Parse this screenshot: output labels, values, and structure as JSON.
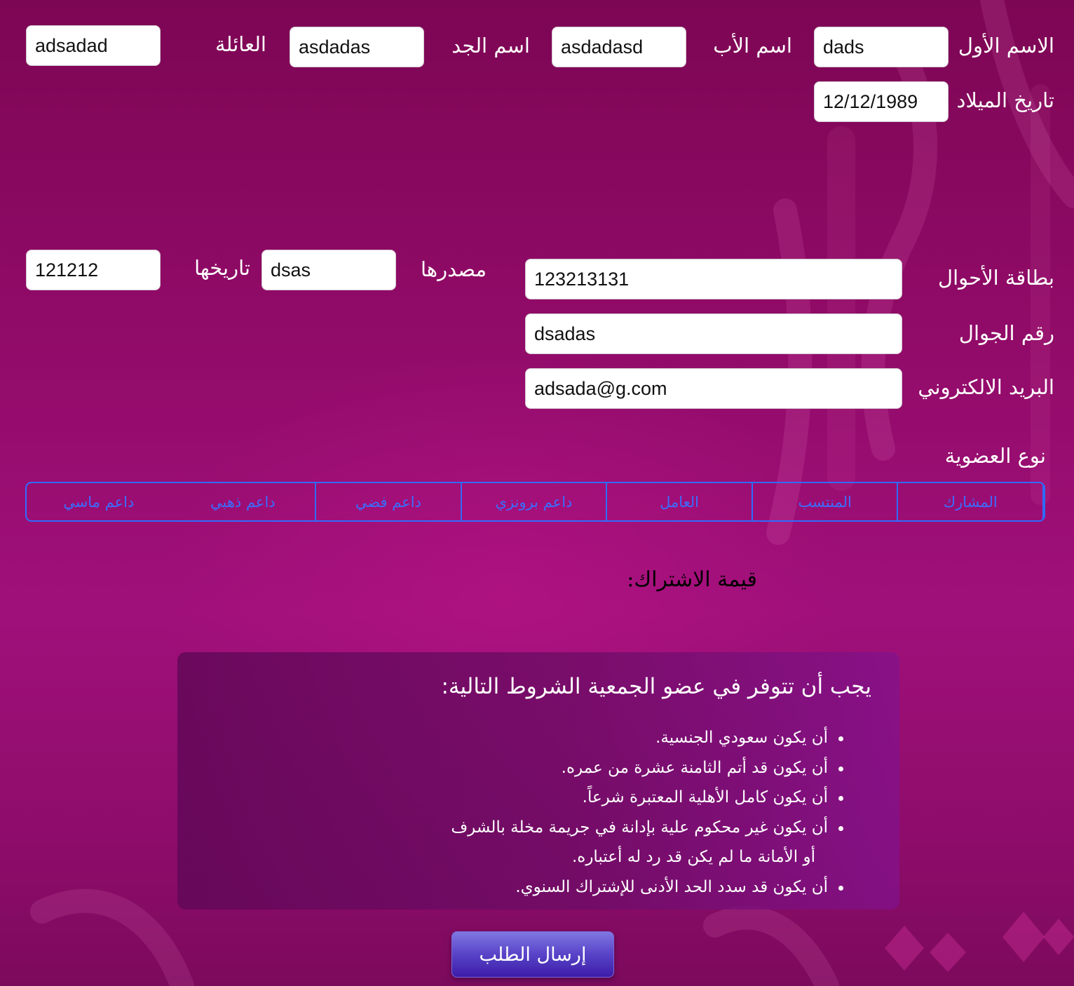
{
  "personal": {
    "first_name_label": "الاسم الأول",
    "first_name_value": "dads",
    "father_name_label": "اسم الأب",
    "father_name_value": "asdadasd",
    "grandfather_name_label": "اسم الجد",
    "grandfather_name_value": "asdadas",
    "family_label": "العائلة",
    "family_value": "adsadad",
    "birthdate_label": "تاريخ الميلاد",
    "birthdate_value": "12/12/1989"
  },
  "id_card": {
    "label": "بطاقة الأحوال",
    "value": "123213131",
    "source_label": "مصدرها",
    "source_value": "dsas",
    "date_label": "تاريخها",
    "date_value": "121212"
  },
  "contact": {
    "mobile_label": "رقم الجوال",
    "mobile_value": "dsadas",
    "email_label": "البريد الالكتروني",
    "email_value": "adsada@g.com"
  },
  "membership": {
    "label": "نوع العضوية",
    "options": [
      "المشارك",
      "المنتسب",
      "العامل",
      "داعم برونزي",
      "داعم فضي",
      "داعم ذهبي",
      "داعم ماسي"
    ]
  },
  "subscription": {
    "label": "قيمة الاشتراك:"
  },
  "conditions": {
    "title": "يجب أن تتوفر في عضو الجمعية الشروط التالية:",
    "items": [
      "أن يكون سعودي الجنسية.",
      "أن يكون قد أتم الثامنة عشرة من عمره.",
      "أن يكون كامل الأهلية المعتبرة شرعاً.",
      "أن يكون غير محكوم علية بإدانة في جريمة مخلة بالشرف",
      "أو الأمانة ما لم يكن قد رد له أعتباره.",
      "أن يكون قد سدد الحد الأدنى للإشتراك السنوي."
    ]
  },
  "submit": {
    "label": "إرسال الطلب"
  },
  "colors": {
    "background": "#9a0e72",
    "segment_accent": "#2f6bff",
    "button": "#5a45c9"
  }
}
